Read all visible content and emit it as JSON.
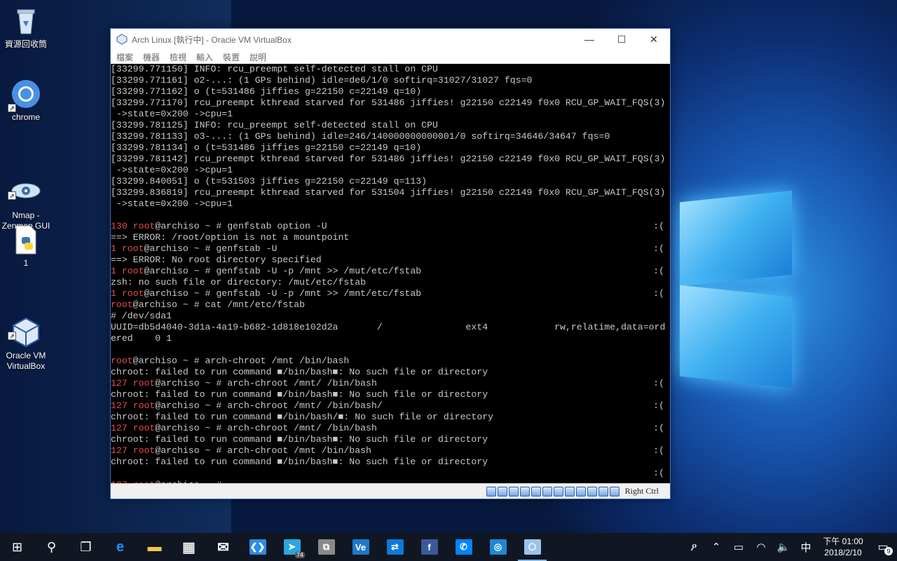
{
  "desktop": {
    "icons": [
      {
        "label": "資源回收筒",
        "icon": "recycle-bin-icon"
      },
      {
        "label": "chrome",
        "icon": "chrome-icon"
      },
      {
        "label": "Nmap -\nZenmap GUI",
        "icon": "nmap-icon"
      },
      {
        "label": "1",
        "icon": "python-file-icon"
      },
      {
        "label": "Oracle VM\nVirtualBox",
        "icon": "virtualbox-icon"
      }
    ]
  },
  "window": {
    "title": "Arch Linux [執行中] - Oracle VM VirtualBox",
    "minimize": "—",
    "maximize": "☐",
    "close": "✕",
    "menu": [
      "檔案",
      "機器",
      "檢視",
      "輸入",
      "裝置",
      "說明"
    ],
    "host_key": "Right Ctrl"
  },
  "console": {
    "lines": [
      {
        "t": "[33299.771150] INFO: rcu_preempt self-detected stall on CPU"
      },
      {
        "t": "[33299.771161] o2-...: (1 GPs behind) idle=de6/1/0 softirq=31027/31027 fqs=0"
      },
      {
        "t": "[33299.771162] o (t=531486 jiffies g=22150 c=22149 q=10)"
      },
      {
        "t": "[33299.771170] rcu_preempt kthread starved for 531486 jiffies! g22150 c22149 f0x0 RCU_GP_WAIT_FQS(3)"
      },
      {
        "t": " ->state=0x200 ->cpu=1"
      },
      {
        "t": "[33299.781125] INFO: rcu_preempt self-detected stall on CPU"
      },
      {
        "t": "[33299.781133] o3-...: (1 GPs behind) idle=246/140000000000001/0 softirq=34646/34647 fqs=0"
      },
      {
        "t": "[33299.781134] o (t=531486 jiffies g=22150 c=22149 q=10)"
      },
      {
        "t": "[33299.781142] rcu_preempt kthread starved for 531486 jiffies! g22150 c22149 f0x0 RCU_GP_WAIT_FQS(3)"
      },
      {
        "t": " ->state=0x200 ->cpu=1"
      },
      {
        "t": "[33299.840051] o (t=531503 jiffies g=22150 c=22149 q=113)"
      },
      {
        "t": "[33299.836819] rcu_preempt kthread starved for 531504 jiffies! g22150 c22149 f0x0 RCU_GP_WAIT_FQS(3)"
      },
      {
        "t": " ->state=0x200 ->cpu=1"
      },
      {
        "t": ""
      },
      {
        "code": "130",
        "user": "root",
        "t": "@archiso ~ # genfstab option -U",
        "r": ":("
      },
      {
        "t": "==> ERROR: /root/option is not a mountpoint"
      },
      {
        "code": "1",
        "user": "root",
        "t": "@archiso ~ # genfstab -U",
        "r": ":("
      },
      {
        "t": "==> ERROR: No root directory specified"
      },
      {
        "code": "1",
        "user": "root",
        "t": "@archiso ~ # genfstab -U -p /mnt >> /mut/etc/fstab",
        "r": ":("
      },
      {
        "t": "zsh: no such file or directory: /mut/etc/fstab"
      },
      {
        "code": "1",
        "user": "root",
        "t": "@archiso ~ # genfstab -U -p /mnt >> /mnt/etc/fstab",
        "r": ":("
      },
      {
        "user": "root",
        "t": "@archiso ~ # cat /mnt/etc/fstab"
      },
      {
        "t": "# /dev/sda1"
      },
      {
        "t": "UUID=db5d4040-3d1a-4a19-b682-1d818e102d2a       /               ext4            rw,relatime,data=ord"
      },
      {
        "t": "ered    0 1"
      },
      {
        "t": ""
      },
      {
        "user": "root",
        "t": "@archiso ~ # arch-chroot /mnt /bin/bash"
      },
      {
        "t": "chroot: failed to run command ■/bin/bash■: No such file or directory"
      },
      {
        "code": "127",
        "user": "root",
        "t": "@archiso ~ # arch-chroot /mnt/ /bin/bash",
        "r": ":("
      },
      {
        "t": "chroot: failed to run command ■/bin/bash■: No such file or directory"
      },
      {
        "code": "127",
        "user": "root",
        "t": "@archiso ~ # arch-chroot /mnt/ /bin/bash/",
        "r": ":("
      },
      {
        "t": "chroot: failed to run command ■/bin/bash/■: No such file or directory"
      },
      {
        "code": "127",
        "user": "root",
        "t": "@archiso ~ # arch-chroot /mnt/ /bin/bash",
        "r": ":("
      },
      {
        "t": "chroot: failed to run command ■/bin/bash■: No such file or directory"
      },
      {
        "code": "127",
        "user": "root",
        "t": "@archiso ~ # arch-chroot /mnt /bin/bash",
        "r": ":("
      },
      {
        "t": "chroot: failed to run command ■/bin/bash■: No such file or directory"
      },
      {
        "t": "",
        "r": ":("
      },
      {
        "code": "127",
        "user": "root",
        "t": "@archiso ~ # ",
        "cursor": true
      }
    ]
  },
  "taskbar": {
    "apps": [
      {
        "name": "start-button",
        "glyph": "⊞"
      },
      {
        "name": "search-button",
        "glyph": "⚲"
      },
      {
        "name": "task-view-button",
        "glyph": "❐"
      },
      {
        "name": "edge-icon",
        "glyph": "e",
        "color": "#1e90ff"
      },
      {
        "name": "file-explorer-icon",
        "glyph": "▬",
        "color": "#f2c744"
      },
      {
        "name": "store-icon",
        "glyph": "▦",
        "color": "#e6e6e6"
      },
      {
        "name": "mail-icon",
        "glyph": "✉",
        "color": "#ffffff"
      },
      {
        "name": "vscode-icon",
        "glyph": "❮❯",
        "color": "#2b8be6"
      },
      {
        "name": "telegram-icon",
        "glyph": "➤",
        "color": "#2ca5e0",
        "badge": "74"
      },
      {
        "name": "network-app-icon",
        "glyph": "⧉",
        "color": "#8a8a8a"
      },
      {
        "name": "ve-app-icon",
        "glyph": "Ve",
        "color": "#1f78c8"
      },
      {
        "name": "teamviewer-icon",
        "glyph": "⇄",
        "color": "#0e7ad6"
      },
      {
        "name": "facebook-icon",
        "glyph": "f",
        "color": "#3b5998"
      },
      {
        "name": "messenger-icon",
        "glyph": "✆",
        "color": "#0084ff"
      },
      {
        "name": "instagram-icon",
        "glyph": "◎",
        "color": "#1d88d6"
      },
      {
        "name": "virtualbox-taskbar-icon",
        "glyph": "⬡",
        "color": "#9bc3ea",
        "active": true
      }
    ],
    "tray": {
      "people": "ዖ",
      "chevron": "⌃",
      "battery": "▭",
      "wifi": "◠",
      "volume": "🔈",
      "ime": "中",
      "time": "下午 01:00",
      "date": "2018/2/10",
      "notifications": "9"
    }
  },
  "colors": {
    "prompt_red": "#e84c4c",
    "console_text": "#c8c8c8",
    "taskbar": "#101722"
  }
}
